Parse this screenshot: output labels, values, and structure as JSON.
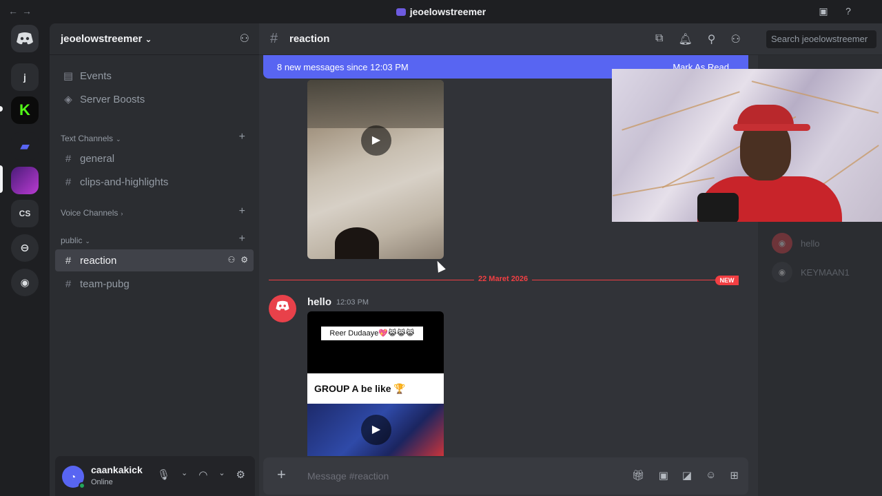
{
  "titlebar": {
    "title": "jeoelowstreemer",
    "nav_back_icon": "arrow-left-icon",
    "nav_forward_icon": "arrow-right-icon"
  },
  "server_rail": {
    "items": [
      {
        "label": "",
        "icon": "discord-home-icon"
      },
      {
        "label": "j"
      },
      {
        "label": "",
        "icon": "kick-icon"
      },
      {
        "label": "",
        "icon": "folder-icon"
      },
      {
        "label": "",
        "icon": "server-avatar"
      },
      {
        "label": "CS"
      },
      {
        "label": "",
        "icon": "discover-icon"
      },
      {
        "label": "",
        "icon": "download-icon"
      }
    ]
  },
  "guild": {
    "name": "jeoelowstreemer",
    "chevron": "⌄"
  },
  "sidebar": {
    "events": "Events",
    "boosts": "Server Boosts",
    "categories": {
      "text": "Text Channels",
      "voice": "Voice Channels",
      "public": "public"
    },
    "channels": {
      "general": "general",
      "clips": "clips-and-highlights",
      "reaction": "reaction",
      "pubg": "team-pubg"
    }
  },
  "user": {
    "name": "caankakick",
    "status": "Online"
  },
  "chat": {
    "channel": "reaction",
    "search_placeholder": "Search jeoelowstreemer",
    "new_messages": "8 new messages since 12:03 PM",
    "mark_as_read": "Mark As Read",
    "divider_date": "22 Maret 2026",
    "new_badge": "NEW",
    "message": {
      "author": "hello",
      "time": "12:03 PM",
      "caption_top": "Reer Dudaaye💖😹😹😹",
      "caption_band": "GROUP A be like 🏆"
    },
    "composer_placeholder": "Message #reaction"
  },
  "members": [
    {
      "name": "hello"
    },
    {
      "name": "KEYMAAN1"
    }
  ],
  "colors": {
    "accent": "#5865f2",
    "new_red": "#f23f43",
    "online": "#23a55a",
    "bg_dark": "#1e1f22",
    "bg_sidebar": "#2b2d31",
    "bg_chat": "#313338"
  }
}
